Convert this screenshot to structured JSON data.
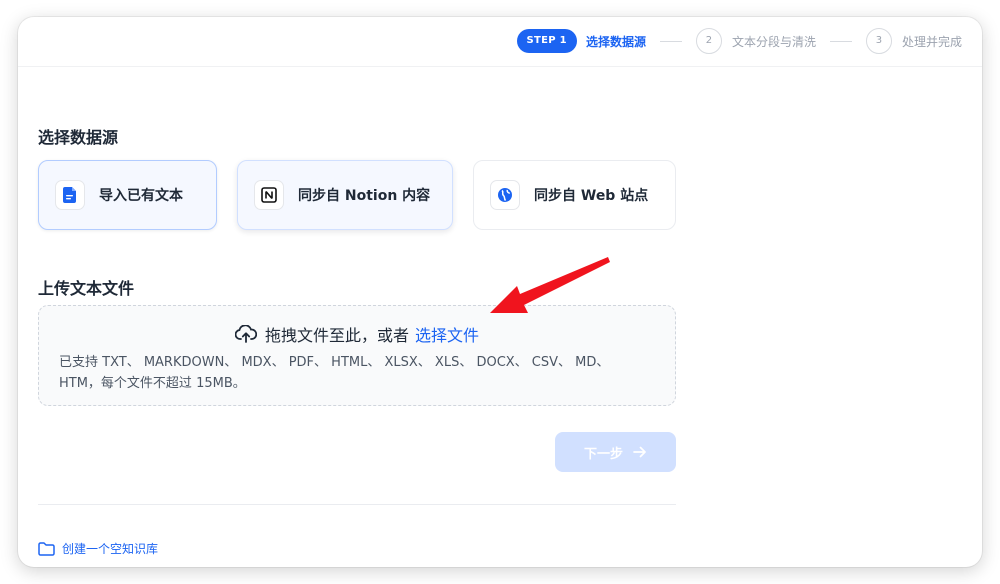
{
  "stepper": {
    "step1_badge": "STEP 1",
    "step1_label": "选择数据源",
    "step2_number": "2",
    "step2_label": "文本分段与清洗",
    "step3_number": "3",
    "step3_label": "处理并完成"
  },
  "source": {
    "title": "选择数据源",
    "options": [
      {
        "label": "导入已有文本",
        "icon": "document-icon",
        "state": "selected"
      },
      {
        "label": "同步自 Notion 内容",
        "icon": "notion-icon",
        "state": "hovered"
      },
      {
        "label": "同步自 Web 站点",
        "icon": "globe-icon",
        "state": "default"
      }
    ]
  },
  "upload": {
    "title": "上传文本文件",
    "drag_text": "拖拽文件至此，或者",
    "select_link": "选择文件",
    "hint": "已支持 TXT、 MARKDOWN、 MDX、 PDF、 HTML、 XLSX、 XLS、 DOCX、 CSV、 MD、 HTM，每个文件不超过 15MB。"
  },
  "actions": {
    "next_label": "下一步",
    "create_empty_label": "创建一个空知识库"
  },
  "colors": {
    "accent": "#1c64f2",
    "annotation_arrow": "#f0141e",
    "next_disabled": "#d1e0ff"
  }
}
